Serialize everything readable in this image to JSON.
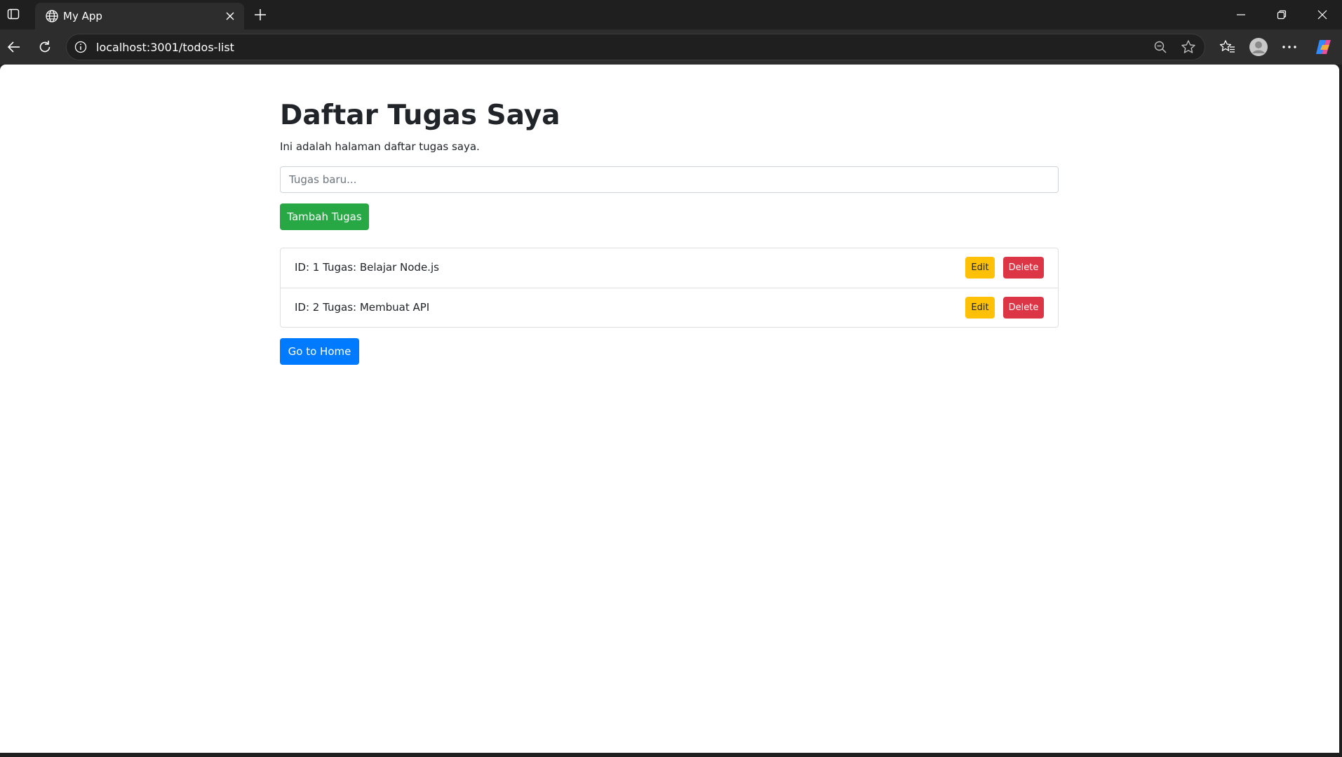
{
  "browser": {
    "tab_title": "My App",
    "url": "localhost:3001/todos-list",
    "icons": {
      "sidebar": "tab-actions-icon",
      "favicon": "globe-icon",
      "close": "close-icon",
      "new_tab": "plus-icon",
      "back": "back-arrow-icon",
      "refresh": "refresh-icon",
      "info": "info-icon",
      "zoom": "zoom-out-icon",
      "favorite": "star-icon",
      "favorites": "favorites-icon",
      "profile": "profile-icon",
      "menu": "more-icon",
      "copilot": "copilot-icon"
    }
  },
  "page": {
    "title": "Daftar Tugas Saya",
    "subtitle": "Ini adalah halaman daftar tugas saya.",
    "input_placeholder": "Tugas baru...",
    "add_button": "Tambah Tugas",
    "home_button": "Go to Home",
    "todos": [
      {
        "text": "ID: 1 Tugas: Belajar Node.js",
        "edit": "Edit",
        "delete": "Delete"
      },
      {
        "text": "ID: 2 Tugas: Membuat API",
        "edit": "Edit",
        "delete": "Delete"
      }
    ]
  },
  "colors": {
    "success": "#28a745",
    "primary": "#007bff",
    "warning": "#ffc107",
    "danger": "#dc3545"
  }
}
